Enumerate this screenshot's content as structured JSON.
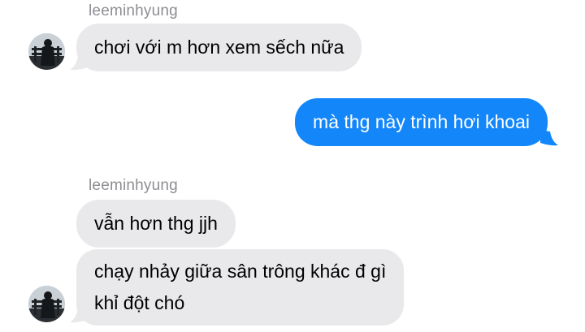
{
  "thread": {
    "messages": [
      {
        "direction": "incoming",
        "sender": "leeminhyung",
        "text": "chơi với m hơn xem sếch nữa"
      },
      {
        "direction": "outgoing",
        "text": "mà thg này trình hơi khoai"
      },
      {
        "direction": "incoming",
        "sender": "leeminhyung",
        "text": "vẫn hơn thg jjh"
      },
      {
        "direction": "incoming",
        "text_line1": "chạy nhảy giữa sân trông khác đ gì",
        "text_line2": "khỉ đột chó"
      }
    ]
  },
  "colors": {
    "incoming_bubble": "#e9e9eb",
    "outgoing_bubble": "#1386fa",
    "sender_name": "#8e8e93"
  },
  "icons": {
    "avatar": "avatar-photo"
  }
}
